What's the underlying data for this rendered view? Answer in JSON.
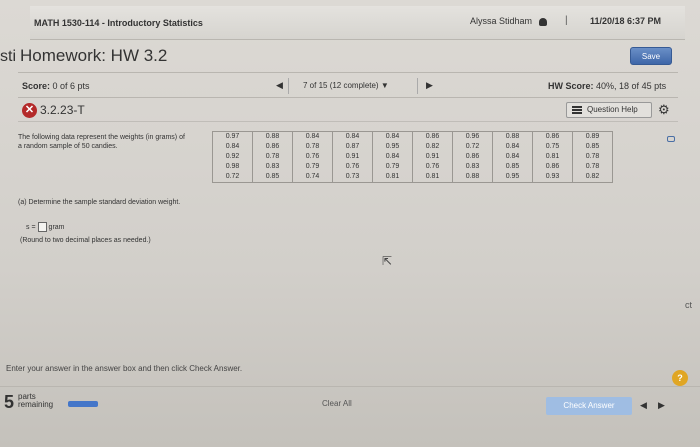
{
  "header": {
    "course": "MATH 1530-114 - Introductory Statistics",
    "user": "Alyssa Stidham",
    "divider": "|",
    "datetime": "11/20/18 6:37 PM"
  },
  "homework": {
    "title_fragment": "sti",
    "title": "Homework: HW 3.2",
    "save_label": "Save"
  },
  "score_bar": {
    "score_label": "Score:",
    "score_value": "0 of 6 pts",
    "prev_arrow": "◀",
    "question_nav": "7 of 15 (12 complete) ▼",
    "next_arrow": "▶",
    "hw_score_label": "HW Score:",
    "hw_score_value": "40%, 18 of 45 pts"
  },
  "question": {
    "status_icon": "x-mark-icon",
    "status_symbol": "✕",
    "id": "3.2.23-T",
    "help_label": "Question Help",
    "gear_symbol": "⚙"
  },
  "problem": {
    "prompt": "The following data represent the weights (in grams) of a random sample of 50 candies.",
    "table_columns": [
      [
        "0.97",
        "0.84",
        "0.92",
        "0.98",
        "0.72"
      ],
      [
        "0.88",
        "0.86",
        "0.78",
        "0.83",
        "0.85"
      ],
      [
        "0.84",
        "0.78",
        "0.76",
        "0.79",
        "0.74"
      ],
      [
        "0.84",
        "0.87",
        "0.91",
        "0.76",
        "0.73"
      ],
      [
        "0.84",
        "0.95",
        "0.84",
        "0.79",
        "0.81"
      ],
      [
        "0.86",
        "0.82",
        "0.91",
        "0.76",
        "0.81"
      ],
      [
        "0.96",
        "0.72",
        "0.86",
        "0.83",
        "0.88"
      ],
      [
        "0.88",
        "0.84",
        "0.84",
        "0.85",
        "0.95"
      ],
      [
        "0.86",
        "0.75",
        "0.81",
        "0.86",
        "0.93"
      ],
      [
        "0.89",
        "0.85",
        "0.78",
        "0.78",
        "0.82"
      ]
    ],
    "part_a": "(a) Determine the sample standard deviation weight.",
    "answer_prefix": "s =",
    "answer_unit": "gram",
    "round_note": "(Round to two decimal places as needed.)"
  },
  "side_fragment": "ct",
  "footer": {
    "instruction": "Enter your answer in the answer box and then click Check Answer.",
    "help_symbol": "?",
    "parts_count": "5",
    "parts_label_1": "parts",
    "parts_label_2": "remaining",
    "progress_fraction": 0.2,
    "clear_all": "Clear All",
    "check_answer": "Check Answer",
    "prev_arrow": "◀",
    "next_arrow": "▶"
  }
}
